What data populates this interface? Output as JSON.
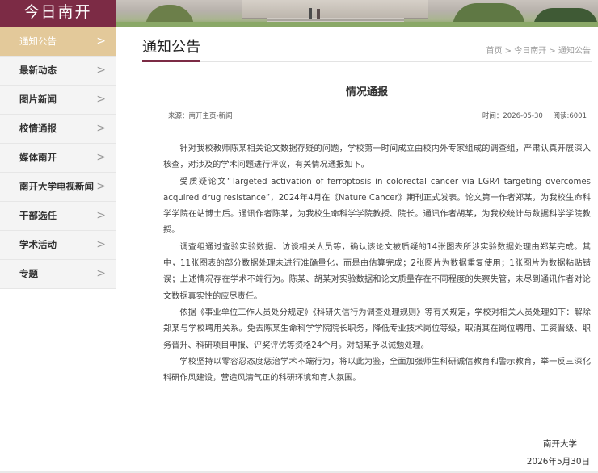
{
  "brand": {
    "name": "今日南开"
  },
  "sidebar": {
    "items": [
      {
        "label": "通知公告",
        "active": true
      },
      {
        "label": "最新动态"
      },
      {
        "label": "图片新闻"
      },
      {
        "label": "校情通报"
      },
      {
        "label": "媒体南开"
      },
      {
        "label": "南开大学电视新闻"
      },
      {
        "label": "干部选任"
      },
      {
        "label": "学术活动"
      },
      {
        "label": "专题"
      }
    ],
    "chevron": ">"
  },
  "header": {
    "title": "通知公告",
    "breadcrumb": [
      "首页",
      "今日南开",
      "通知公告"
    ],
    "separator": ">"
  },
  "article": {
    "title": "情况通报",
    "source": "来源：南开主页-新闻",
    "time": "时间：2026-05-30",
    "views": "阅读:6001",
    "paragraphs": [
      "针对我校教师陈某相关论文数据存疑的问题，学校第一时间成立由校内外专家组成的调查组，严肃认真开展深入核查，对涉及的学术问题进行评议，有关情况通报如下。",
      "受质疑论文“Targeted activation of ferroptosis in colorectal cancer via LGR4 targeting overcomes acquired drug resistance”，2024年4月在《Nature Cancer》期刊正式发表。论文第一作者郑某，为我校生命科学学院在站博士后。通讯作者陈某，为我校生命科学学院教授、院长。通讯作者胡某，为我校统计与数据科学学院教授。",
      "调查组通过查验实验数据、访谈相关人员等，确认该论文被质疑的14张图表所涉实验数据处理由郑某完成。其中，11张图表的部分数据处理未进行准确量化，而是由估算完成；2张图片为数据重复使用；1张图片为数据粘贴错误；上述情况存在学术不端行为。陈某、胡某对实验数据和论文质量存在不同程度的失察失管，未尽到通讯作者对论文数据真实性的应尽责任。",
      "依据《事业单位工作人员处分规定》《科研失信行为调查处理规则》等有关规定，学校对相关人员处理如下：解除郑某与学校聘用关系。免去陈某生命科学学院院长职务，降低专业技术岗位等级，取消其在岗位聘用、工资晋级、职务晋升、科研项目申报、评奖评优等资格24个月。对胡某予以诫勉处理。",
      "学校坚持以零容忍态度惩治学术不端行为，将以此为鉴，全面加强师生科研诚信教育和警示教育，举一反三深化科研作风建设，营造风清气正的科研环境和育人氛围。"
    ],
    "signature": "南开大学",
    "date": "2026年5月30日"
  }
}
